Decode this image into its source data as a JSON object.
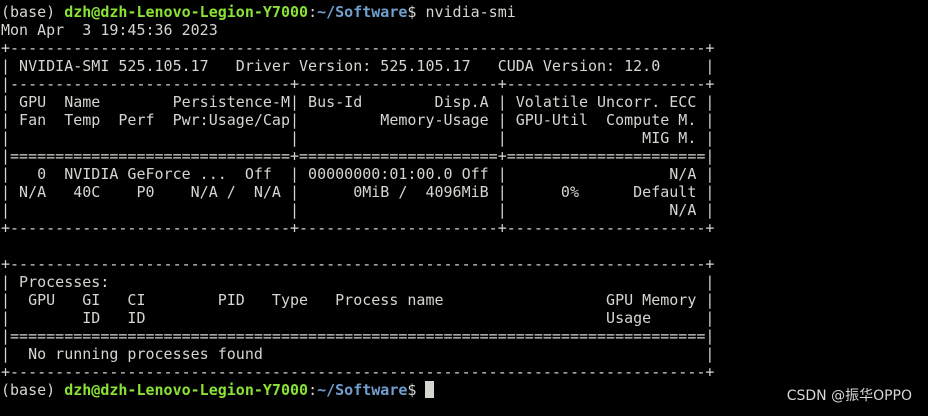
{
  "prompt": {
    "env": "(base) ",
    "user_host": "dzh@dzh-Lenovo-Legion-Y7000",
    "separator": ":",
    "path": "~/Software",
    "symbol": "$ ",
    "command": "nvidia-smi"
  },
  "output_lines": [
    "Mon Apr  3 19:45:36 2023",
    "+-----------------------------------------------------------------------------+",
    "| NVIDIA-SMI 525.105.17   Driver Version: 525.105.17   CUDA Version: 12.0     |",
    "|-------------------------------+----------------------+----------------------+",
    "| GPU  Name        Persistence-M| Bus-Id        Disp.A | Volatile Uncorr. ECC |",
    "| Fan  Temp  Perf  Pwr:Usage/Cap|         Memory-Usage | GPU-Util  Compute M. |",
    "|                               |                      |               MIG M. |",
    "|===============================+======================+======================|",
    "|   0  NVIDIA GeForce ...  Off  | 00000000:01:00.0 Off |                  N/A |",
    "| N/A   40C    P0    N/A /  N/A |      0MiB /  4096MiB |      0%      Default |",
    "|                               |                      |                  N/A |",
    "+-------------------------------+----------------------+----------------------+",
    "",
    "+-----------------------------------------------------------------------------+",
    "| Processes:                                                                  |",
    "|  GPU   GI   CI        PID   Type   Process name                  GPU Memory |",
    "|        ID   ID                                                   Usage      |",
    "|=============================================================================|",
    "|  No running processes found                                                 |",
    "+-----------------------------------------------------------------------------+"
  ],
  "watermark": "CSDN @振华OPPO"
}
